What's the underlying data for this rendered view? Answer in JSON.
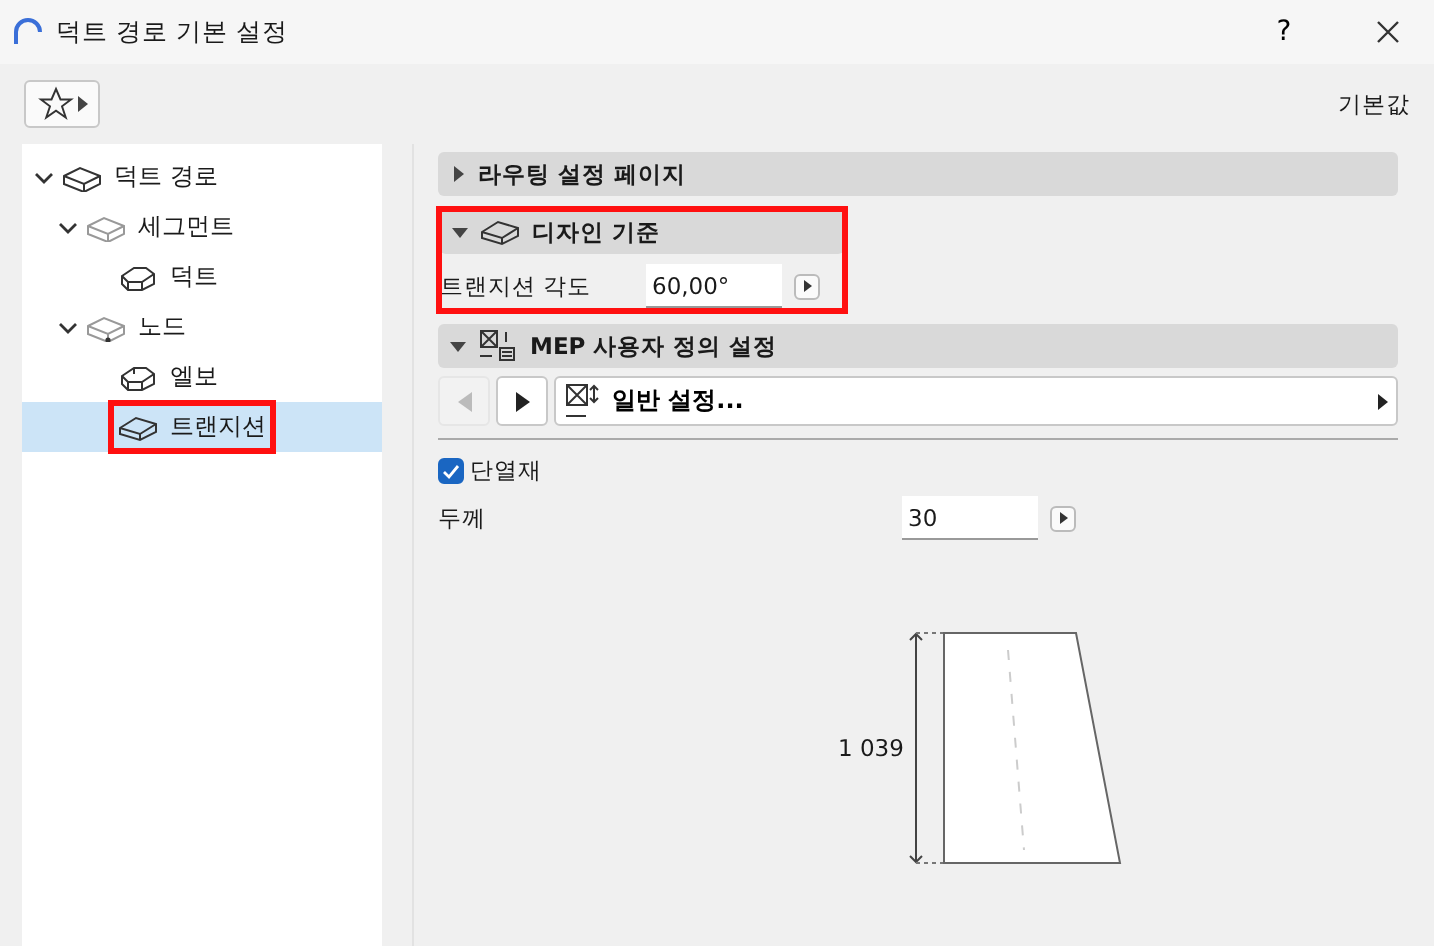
{
  "window": {
    "title": "덕트 경로 기본 설정",
    "help": "?"
  },
  "toolbar": {
    "default_label": "기본값"
  },
  "tree": [
    {
      "label": "덕트 경로",
      "kind": "route",
      "expanded": true,
      "selected": false,
      "highlighted": false,
      "children": [
        {
          "label": "세그먼트",
          "kind": "segment",
          "expanded": true,
          "selected": false,
          "highlighted": false,
          "children": [
            {
              "label": "덕트",
              "kind": "duct",
              "selected": false,
              "highlighted": false
            }
          ]
        },
        {
          "label": "노드",
          "kind": "node",
          "expanded": true,
          "selected": false,
          "highlighted": false,
          "children": [
            {
              "label": "엘보",
              "kind": "elbow",
              "selected": false,
              "highlighted": false
            },
            {
              "label": "트랜지션",
              "kind": "transition",
              "selected": true,
              "highlighted": true
            }
          ]
        }
      ]
    }
  ],
  "sections": [
    {
      "title": "라우팅 설정 페이지",
      "kind": "plain",
      "expanded": false,
      "highlighted": false
    },
    {
      "title": "디자인 기준",
      "kind": "design",
      "expanded": true,
      "highlighted": true,
      "fields": [
        {
          "label": "트랜지션 각도",
          "value": "60,00°"
        }
      ]
    },
    {
      "title": "MEP 사용자 정의 설정",
      "kind": "custom",
      "expanded": true,
      "highlighted": false
    }
  ],
  "custom": {
    "prev_disabled": true,
    "page": "일반 설정...",
    "insulation": {
      "label": "단열재",
      "checked": true
    },
    "thickness": {
      "label": "두께",
      "value": "30"
    },
    "dimension": "1 039"
  }
}
